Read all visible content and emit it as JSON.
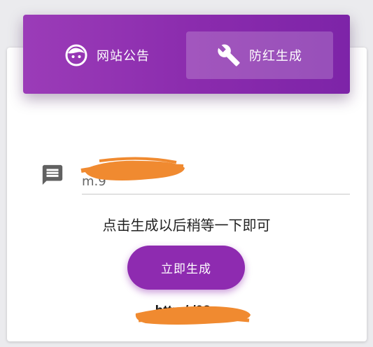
{
  "tabs": [
    {
      "label": "网站公告",
      "icon": "face-icon",
      "active": false
    },
    {
      "label": "防红生成",
      "icon": "wrench-icon",
      "active": true
    }
  ],
  "input": {
    "value": "m.9"
  },
  "hint": "点击生成以后稍等一下即可",
  "generate_button": "立即生成",
  "result_link": "http:/                 /03a",
  "colors": {
    "accent": "#8e2bb0",
    "redaction": "#f08a30"
  }
}
